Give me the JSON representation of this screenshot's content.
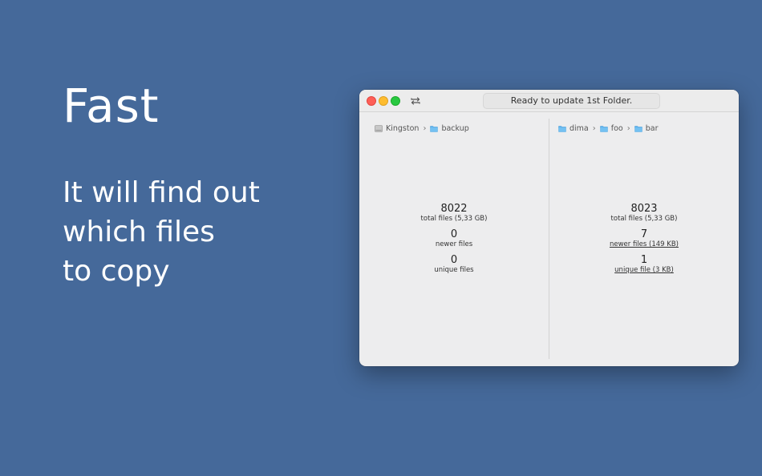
{
  "promo": {
    "headline": "Fast",
    "lines": [
      "It will find out",
      "which files",
      "to copy"
    ]
  },
  "window": {
    "status_text": "Ready to update 1st Folder.",
    "left": {
      "breadcrumb": [
        {
          "label": "Kingston",
          "icon": "drive-icon"
        },
        {
          "label": "backup",
          "icon": "folder-icon"
        }
      ],
      "stats": [
        {
          "value": "8022",
          "label": "total files (5,33 GB)"
        },
        {
          "value": "0",
          "label": "newer files"
        },
        {
          "value": "0",
          "label": "unique files"
        }
      ]
    },
    "right": {
      "breadcrumb": [
        {
          "label": "dima",
          "icon": "folder-icon"
        },
        {
          "label": "foo",
          "icon": "folder-icon"
        },
        {
          "label": "bar",
          "icon": "folder-icon"
        }
      ],
      "stats": [
        {
          "value": "8023",
          "label": "total files (5,33 GB)"
        },
        {
          "value": "7",
          "label": "newer files (149 KB)"
        },
        {
          "value": "1",
          "label": "unique file (3 KB)"
        }
      ]
    }
  },
  "colors": {
    "background": "#45699a",
    "folder": "#5fb4ee",
    "close": "#fe5f57",
    "minimize": "#febc2e",
    "maximize": "#28c840"
  }
}
